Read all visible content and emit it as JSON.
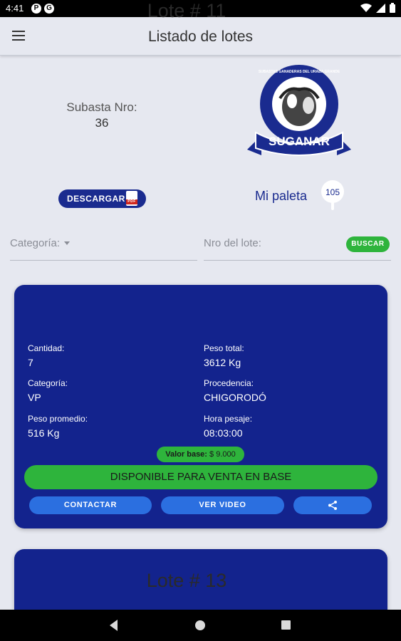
{
  "status_bar": {
    "time": "4:41",
    "notif1": "P",
    "notif2": "G"
  },
  "app_bar": {
    "title": "Listado de lotes"
  },
  "header": {
    "subasta_label": "Subasta Nro:",
    "subasta_number": "36",
    "logo_text": "SUGANAR",
    "logo_subtext": "SUBASTAS GANADERAS DEL URABA GRANDE",
    "descargar_label": "DESCARGAR",
    "pdf_text": "PDF",
    "mi_paleta_label": "Mi paleta",
    "paleta_number": "105"
  },
  "filters": {
    "categoria_label": "Categoría:",
    "lote_placeholder": "Nro del lote:",
    "buscar_label": "BUSCAR"
  },
  "lotes": [
    {
      "title": "Lote # 11",
      "cantidad_label": "Cantidad:",
      "cantidad": "7",
      "peso_total_label": "Peso total:",
      "peso_total": "3612 Kg",
      "categoria_label": "Categoría:",
      "categoria": "VP",
      "procedencia_label": "Procedencia:",
      "procedencia": "CHIGORODÓ",
      "peso_promedio_label": "Peso promedio:",
      "peso_promedio": "516 Kg",
      "hora_pesaje_label": "Hora pesaje:",
      "hora_pesaje": "08:03:00",
      "valor_base_label": "Valor base:",
      "valor_base": "$ 9.000",
      "estado": "DISPONIBLE PARA VENTA EN BASE",
      "contactar_label": "CONTACTAR",
      "ver_video_label": "VER VIDEO"
    },
    {
      "title": "Lote # 13"
    }
  ],
  "colors": {
    "card_bg": "#13238d",
    "accent_green": "#2eb43c",
    "action_blue": "#2b6fe0",
    "brand_navy": "#1a2b8f"
  },
  "icons": [
    "menu-icon",
    "pdf-icon",
    "paddle-icon",
    "share-icon",
    "wifi-icon",
    "battery-icon"
  ]
}
